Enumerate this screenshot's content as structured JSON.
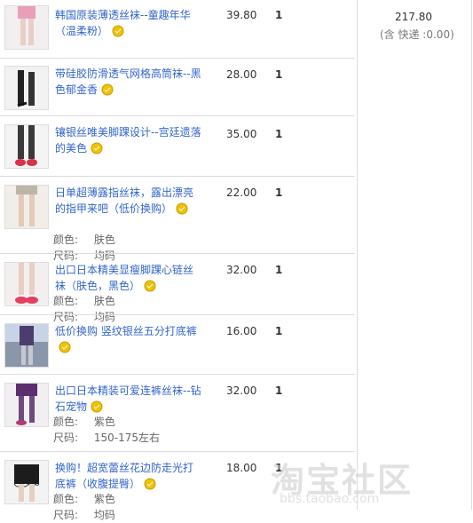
{
  "order": {
    "total": "217.80",
    "shipping": "(含 快递 :0.00)"
  },
  "items": [
    {
      "title": "韩国原装薄透丝袜--童趣年华（温柔粉）",
      "price": "39.80",
      "qty": "1",
      "attrs": null
    },
    {
      "title": "带硅胶防滑透气网格高筒袜--黑色郁金香",
      "price": "28.00",
      "qty": "1",
      "attrs": null
    },
    {
      "title": "镶银丝唯美脚踝设计--宫廷遗落的美色",
      "price": "35.00",
      "qty": "1",
      "attrs": null
    },
    {
      "title": "日单超薄露指丝袜，露出漂亮的指甲来吧（低价换购）",
      "price": "22.00",
      "qty": "1",
      "color_label": "颜色:",
      "color_value": "肤色",
      "size_label": "尺码:",
      "size_value": "均码"
    },
    {
      "title": "出口日本精美显瘦脚踝心链丝袜（肤色，黑色）",
      "price": "32.00",
      "qty": "1",
      "color_label": "颜色:",
      "color_value": "肤色",
      "size_label": "尺码:",
      "size_value": "均码"
    },
    {
      "title": "低价换购 竖纹银丝五分打底裤",
      "price": "16.00",
      "qty": "1",
      "attrs": null
    },
    {
      "title": "出口日本精装可爱连裤丝袜--钻石宠物",
      "price": "32.00",
      "qty": "1",
      "color_label": "颜色:",
      "color_value": "紫色",
      "size_label": "尺码:",
      "size_value": "150-175左右"
    },
    {
      "title": "换购！超宽蕾丝花边防走光打底裤（收腹提臀）",
      "price": "18.00",
      "qty": "1",
      "color_label": "颜色:",
      "color_value": "紫色",
      "size_label": "尺码:",
      "size_value": "均码"
    }
  ],
  "icons": {
    "medal": "gold-medal-icon"
  },
  "colors": {
    "link": "#3366cc",
    "border": "#dcdcdc"
  },
  "watermark": {
    "text": "淘宝社区",
    "url": "bbs.taobao.com"
  }
}
